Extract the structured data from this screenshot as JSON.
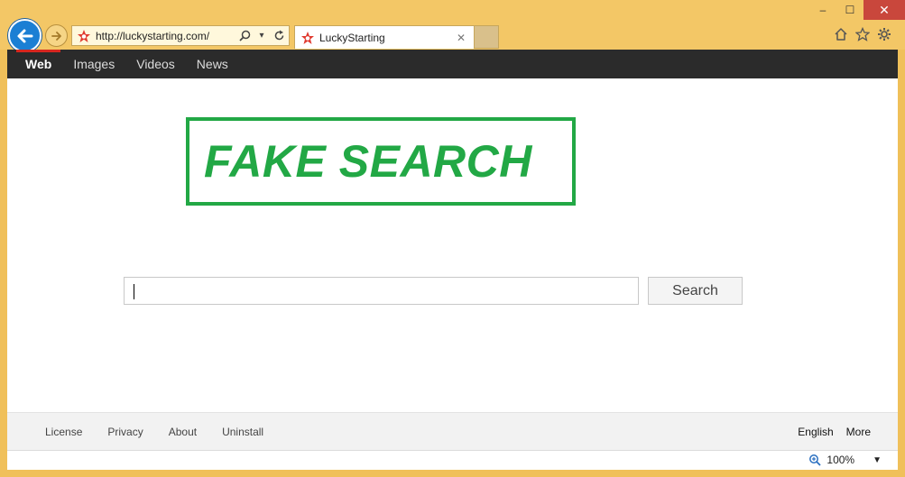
{
  "browser": {
    "address_url": "http://luckystarting.com/",
    "tab_title": "LuckyStarting",
    "window_controls": {
      "minimize": "–",
      "maximize": "☐",
      "close": "✕"
    },
    "icons": [
      "back-arrow-icon",
      "forward-arrow-icon",
      "search-icon",
      "dropdown-icon",
      "refresh-icon",
      "home-icon",
      "star-icon",
      "gear-icon"
    ]
  },
  "nav": {
    "items": [
      {
        "label": "Web",
        "active": true
      },
      {
        "label": "Images",
        "active": false
      },
      {
        "label": "Videos",
        "active": false
      },
      {
        "label": "News",
        "active": false
      }
    ]
  },
  "stamp": {
    "text": "FAKE SEARCH",
    "color": "#22a845"
  },
  "search": {
    "value": "",
    "button_label": "Search"
  },
  "footer": {
    "left_links": [
      "License",
      "Privacy",
      "About",
      "Uninstall"
    ],
    "right_links": [
      "English",
      "More"
    ]
  },
  "status": {
    "zoom": "100%"
  },
  "colors": {
    "chrome": "#f3c766",
    "nav_bg": "#2b2b2b",
    "active_accent": "#d6261f",
    "back_button": "#1b7fd4"
  }
}
